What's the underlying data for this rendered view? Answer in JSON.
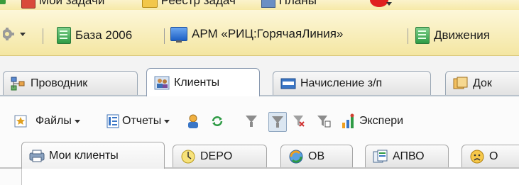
{
  "quick_links": [
    {
      "label": "Мои задачи",
      "icon": "task-list-icon"
    },
    {
      "label": "Реестр задач",
      "icon": "folder-icon"
    },
    {
      "label": "Планы",
      "icon": "plans-icon"
    }
  ],
  "sections_panel": {
    "items": [
      {
        "label": "База 2006",
        "icon": "green-section-icon"
      },
      {
        "label": "АРМ «РИЦ:ГорячаяЛиния»",
        "icon": "monitor-icon"
      },
      {
        "label": "Движения",
        "icon": "green-section-icon"
      }
    ]
  },
  "main_tabs": [
    {
      "label": "Проводник",
      "icon": "tree-icon"
    },
    {
      "label": "Клиенты",
      "icon": "clients-icon",
      "active": true
    },
    {
      "label": "Начисление з/п",
      "icon": "card-icon"
    },
    {
      "label": "Док",
      "icon": "documents-icon"
    }
  ],
  "toolbar": {
    "files_label": "Файлы",
    "reports_label": "Отчеты",
    "expert_label": "Экспери"
  },
  "sub_tabs": [
    {
      "label": "Мои клиенты",
      "icon": "printer-icon",
      "active": true
    },
    {
      "label": "DEPO",
      "icon": "clock-icon"
    },
    {
      "label": "ОВ",
      "icon": "refresh-globe-icon"
    },
    {
      "label": "АПВО",
      "icon": "documents-icon"
    },
    {
      "label": "О",
      "icon": "sad-face-icon"
    }
  ],
  "colors": {
    "panel_yellow": "#f6e9a7",
    "tab_active": "#ffffff",
    "tab_border": "#9aa7b5",
    "toolbar_bg": "#fbfbfb"
  }
}
